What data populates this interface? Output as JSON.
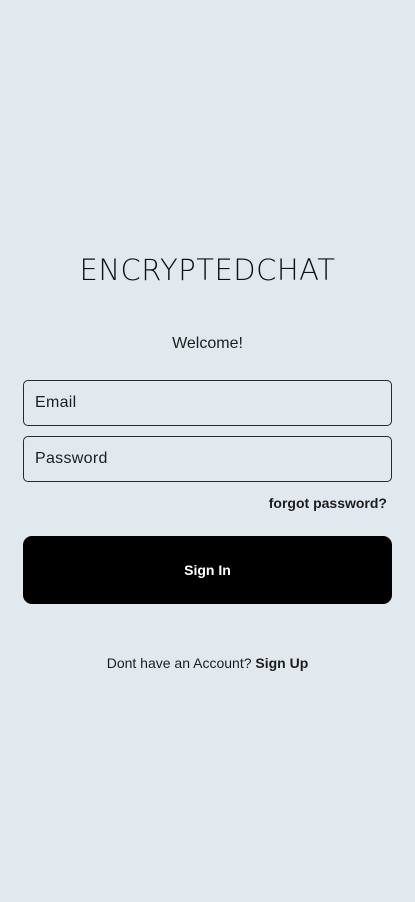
{
  "app": {
    "logo_text": "ENCRYPTEDCHAT",
    "welcome": "Welcome!"
  },
  "form": {
    "email_placeholder": "Email",
    "email_value": "",
    "password_placeholder": "Password",
    "password_value": "",
    "forgot_label": "forgot password?",
    "signin_label": "Sign In"
  },
  "footer": {
    "prompt": "Dont have an Account?",
    "signup_label": "Sign Up"
  },
  "colors": {
    "background": "#e1e9ef",
    "button": "#000000",
    "button_text": "#ffffff",
    "text": "#1d1d1d"
  }
}
